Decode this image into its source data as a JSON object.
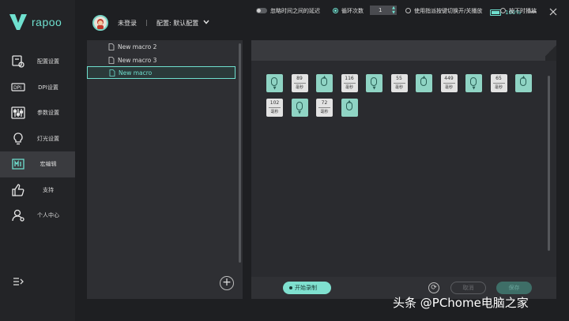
{
  "brand": {
    "name": "rapoo"
  },
  "header": {
    "user": "未登录",
    "separator": "|",
    "config": "配置: 默认配置",
    "battery": "100%"
  },
  "sidebar": {
    "items": [
      {
        "label": "配置设置",
        "icon": "config-icon"
      },
      {
        "label": "DPI设置",
        "icon": "dpi-icon"
      },
      {
        "label": "参数设置",
        "icon": "sliders-icon"
      },
      {
        "label": "灯光设置",
        "icon": "bulb-icon"
      },
      {
        "label": "宏编辑",
        "icon": "macro-icon"
      },
      {
        "label": "支持",
        "icon": "thumbs-up-icon"
      },
      {
        "label": "个人中心",
        "icon": "person-icon"
      }
    ]
  },
  "macros": [
    "New macro 2",
    "New macro 3",
    "New macro"
  ],
  "options": {
    "ignore_delay": "忽略时间之间的延迟",
    "loop_count": "循环次数",
    "loop_value": "1",
    "toggle_play": "使用指派按键切换开/关播放",
    "hold_play": "按下时播放"
  },
  "steps": [
    {
      "type": "key",
      "dir": "down"
    },
    {
      "type": "delay",
      "value": "89",
      "unit": "毫秒"
    },
    {
      "type": "key",
      "dir": "up"
    },
    {
      "type": "delay",
      "value": "116",
      "unit": "毫秒"
    },
    {
      "type": "key",
      "dir": "down"
    },
    {
      "type": "delay",
      "value": "55",
      "unit": "毫秒"
    },
    {
      "type": "key",
      "dir": "up"
    },
    {
      "type": "delay",
      "value": "449",
      "unit": "毫秒"
    },
    {
      "type": "key",
      "dir": "down"
    },
    {
      "type": "delay",
      "value": "65",
      "unit": "毫秒"
    },
    {
      "type": "key",
      "dir": "up"
    },
    {
      "type": "delay",
      "value": "102",
      "unit": "毫秒"
    },
    {
      "type": "key",
      "dir": "down"
    },
    {
      "type": "delay",
      "value": "72",
      "unit": "毫秒"
    },
    {
      "type": "key",
      "dir": "up"
    }
  ],
  "footer": {
    "record": "开始录制",
    "cancel": "取消",
    "save": "保存"
  },
  "watermark": "头条 @PChome电脑之家",
  "colors": {
    "accent": "#6fe0cf",
    "background": "#1e1f22"
  }
}
